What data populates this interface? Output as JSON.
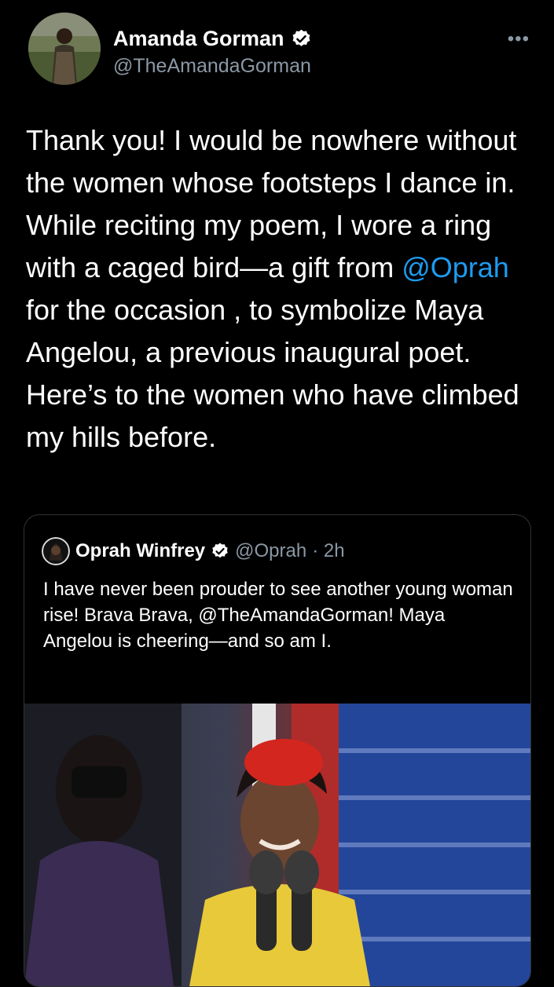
{
  "tweet": {
    "author_name": "Amanda Gorman",
    "author_handle": "@TheAmandaGorman",
    "more_icon": "more-horizontal-icon",
    "text_before_mention": "Thank you! I would be nowhere without the women whose footsteps I dance in. While reciting my poem, I wore a ring with a caged bird—a gift from ",
    "mention": "@Oprah",
    "text_after_mention": " for the occasion , to symbolize Maya Angelou, a previous inaugural poet. Here’s to the women who have climbed my hills before."
  },
  "quoted_tweet": {
    "author_name": "Oprah Winfrey",
    "author_handle": "@Oprah",
    "time": "· 2h",
    "text": "I have never been prouder to see another young woman rise! Brava Brava, @TheAmandaGorman! Maya Angelou is cheering—and so am I."
  },
  "colors": {
    "background": "#000000",
    "link": "#1d9bf0",
    "secondary_text": "#8b98a5",
    "verified_badge": "#ffffff"
  }
}
